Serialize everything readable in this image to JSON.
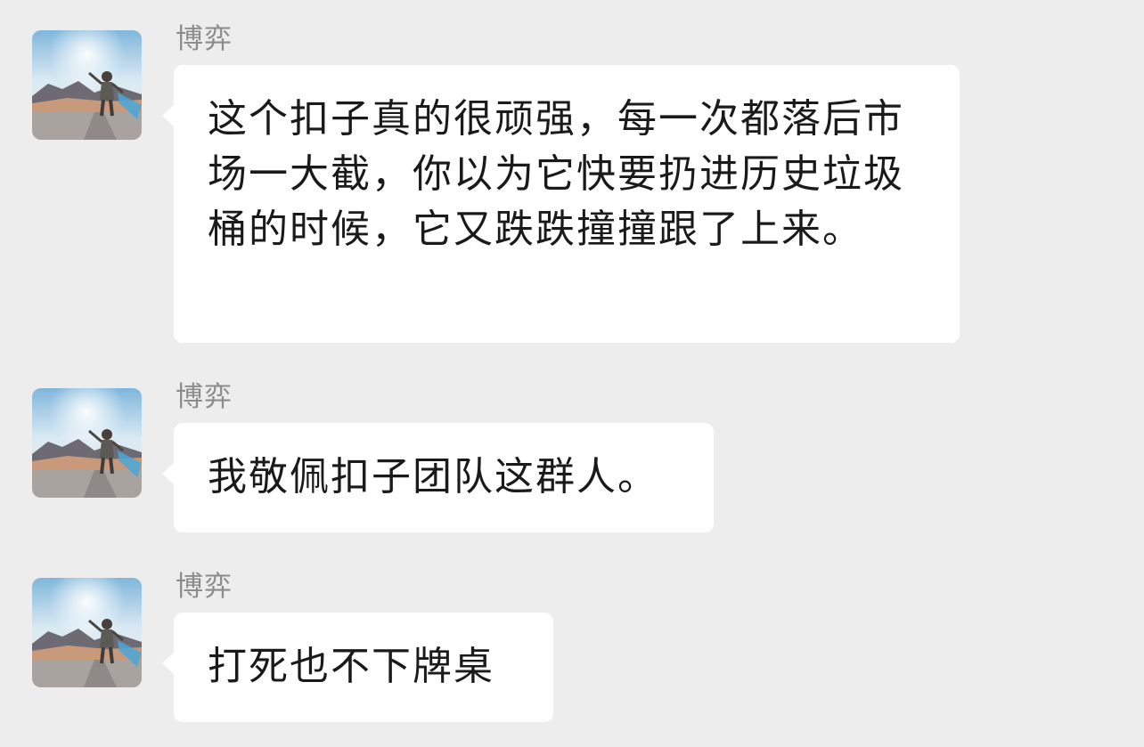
{
  "messages": [
    {
      "sender": "博弈",
      "avatar": "traveler-photo-avatar",
      "text": "这个扣子真的很顽强，每一次都落后市场一大截，你以为它快要扔进历史垃圾桶的时候，它又跌跌撞撞跟了上来。"
    },
    {
      "sender": "博弈",
      "avatar": "traveler-photo-avatar",
      "text": "我敬佩扣子团队这群人。"
    },
    {
      "sender": "博弈",
      "avatar": "traveler-photo-avatar",
      "text": "打死也不下牌桌"
    }
  ],
  "colors": {
    "background": "#ededed",
    "bubble": "#ffffff",
    "sender_name": "#8c8c8c",
    "message_text": "#1a1a1a"
  }
}
